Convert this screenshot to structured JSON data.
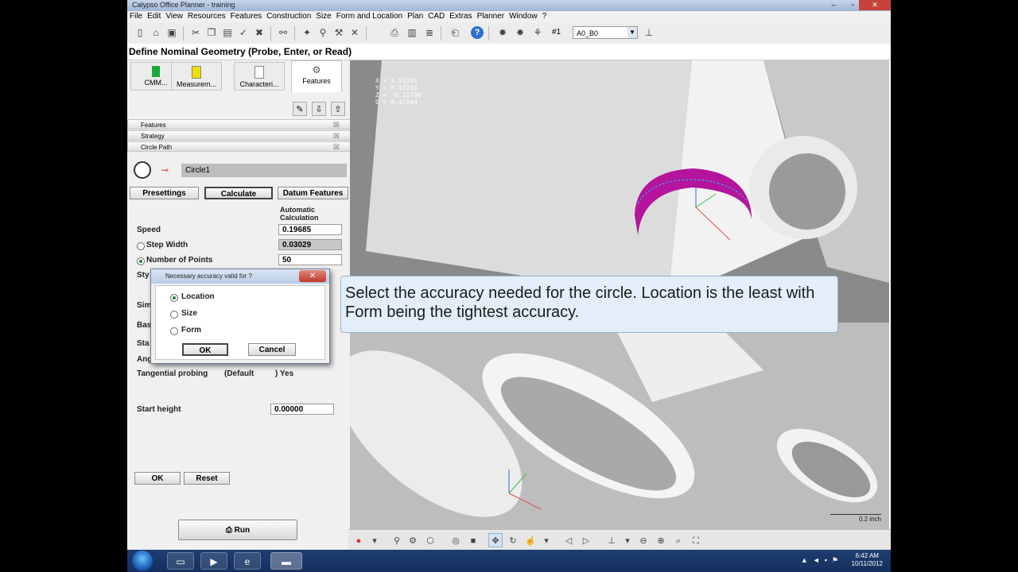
{
  "window": {
    "title": "Calypso Office Planner - training",
    "minimize": "–",
    "maximize": "▫",
    "close": "✕"
  },
  "menu": [
    "File",
    "Edit",
    "View",
    "Resources",
    "Features",
    "Construction",
    "Size",
    "Form and Location",
    "Plan",
    "CAD",
    "Extras",
    "Planner",
    "Window",
    "?"
  ],
  "toolbar": {
    "hash_label": "#1",
    "alignment_value": "A0_B0"
  },
  "header": {
    "title": "Define Nominal Geometry (Probe, Enter, or Read)"
  },
  "tabs": [
    {
      "label": "CMM...",
      "color": "#1fa83a"
    },
    {
      "label": "Measurem...",
      "color": "#f0e000"
    },
    {
      "label": "Characteri...",
      "color": "#ffffff"
    },
    {
      "label": "Features",
      "color": "#ffffff"
    }
  ],
  "stack_panels": [
    "Features",
    "Strategy",
    "Circle Path"
  ],
  "feature": {
    "name": "Circle1",
    "presettings": "Presettings",
    "calculate": "Calculate",
    "datum_features": "Datum Features",
    "auto_calc_label": "Automatic Calculation",
    "speed_label": "Speed",
    "speed_value": "0.19685",
    "step_width_label": "Step Width",
    "step_width_value": "0.03029",
    "num_points_label": "Number of Points",
    "num_points_value": "50",
    "sty_label": "Sty",
    "sim_label": "Sim",
    "bas_label": "Bas",
    "sta_label": "Sta",
    "ang_label": "Ang",
    "tangential_label": "Tangential probing",
    "default_label": "(Default",
    "yes_label": ") Yes",
    "start_height_label": "Start height",
    "start_height_value": "0.00000",
    "ok": "OK",
    "reset": "Reset",
    "run": "Run"
  },
  "dialog": {
    "title": "Necessary accuracy valid for ?",
    "close": "✕",
    "options": [
      "Location",
      "Size",
      "Form"
    ],
    "selected": "Location",
    "ok": "OK",
    "cancel": "Cancel"
  },
  "viewport": {
    "coords": [
      "X =    1.51181",
      "Y =    0.32283",
      "Z =   -0.11760",
      "D =    0.47244"
    ],
    "scale": "0.2 inch"
  },
  "tooltip": {
    "text": "Select the accuracy needed for the circle. Location is the least with Form being the tightest accuracy."
  },
  "taskbar": {
    "time": "6:42 AM",
    "date": "10/11/2012"
  },
  "colors": {
    "accent_magenta": "#b4159c",
    "tooltip_bg": "#e3eef8",
    "taskbar": "#1e3d71"
  }
}
